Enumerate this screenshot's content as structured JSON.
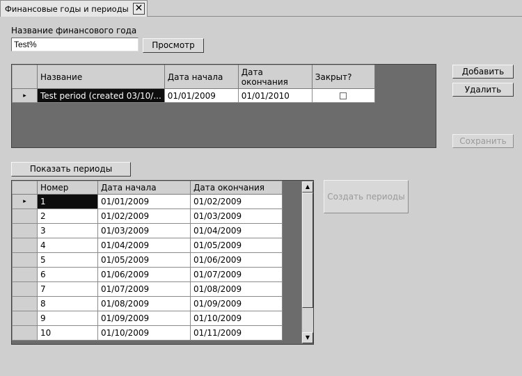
{
  "tab": {
    "title": "Финансовые годы и периоды",
    "close_glyph": "✕"
  },
  "filter": {
    "label": "Название финансового года",
    "value": "Test%",
    "view_button": "Просмотр"
  },
  "years_grid": {
    "columns": [
      "Название",
      "Дата начала",
      "Дата\nокончания",
      "Закрыт?"
    ],
    "rows": [
      {
        "name": "Test period (created 03/10/...",
        "start": "01/01/2009",
        "end": "01/01/2010",
        "closed": false
      }
    ]
  },
  "actions": {
    "add": "Добавить",
    "delete": "Удалить",
    "save": "Сохранить"
  },
  "periods": {
    "show_button": "Показать периоды",
    "create_button": "Создать периоды",
    "columns": [
      "Номер",
      "Дата начала",
      "Дата окончания"
    ],
    "rows": [
      [
        "1",
        "01/01/2009",
        "01/02/2009"
      ],
      [
        "2",
        "01/02/2009",
        "01/03/2009"
      ],
      [
        "3",
        "01/03/2009",
        "01/04/2009"
      ],
      [
        "4",
        "01/04/2009",
        "01/05/2009"
      ],
      [
        "5",
        "01/05/2009",
        "01/06/2009"
      ],
      [
        "6",
        "01/06/2009",
        "01/07/2009"
      ],
      [
        "7",
        "01/07/2009",
        "01/08/2009"
      ],
      [
        "8",
        "01/08/2009",
        "01/09/2009"
      ],
      [
        "9",
        "01/09/2009",
        "01/10/2009"
      ],
      [
        "10",
        "01/10/2009",
        "01/11/2009"
      ]
    ]
  },
  "glyphs": {
    "row_pointer": "▸",
    "scroll_up": "▲",
    "scroll_down": "▼"
  }
}
